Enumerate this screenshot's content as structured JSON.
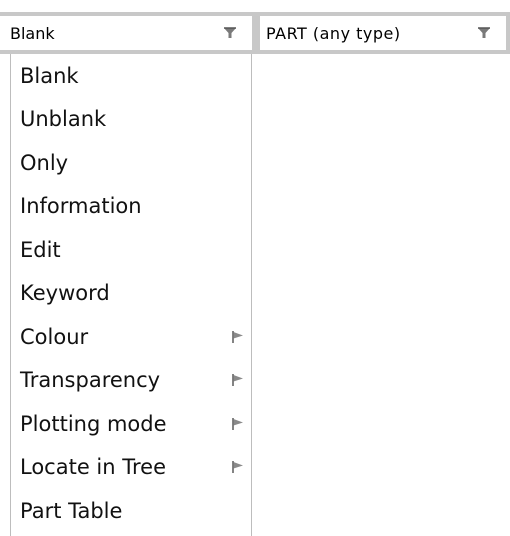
{
  "combo_left": {
    "value": "Blank",
    "arrow_icon": "filter-funnel-icon"
  },
  "combo_right": {
    "value": "PART  (any type)",
    "arrow_icon": "filter-funnel-icon"
  },
  "menu": {
    "items": [
      {
        "label": "Blank",
        "has_submenu": false
      },
      {
        "label": "Unblank",
        "has_submenu": false
      },
      {
        "label": "Only",
        "has_submenu": false
      },
      {
        "label": "Information",
        "has_submenu": false
      },
      {
        "label": "Edit",
        "has_submenu": false
      },
      {
        "label": "Keyword",
        "has_submenu": false
      },
      {
        "label": "Colour",
        "has_submenu": true
      },
      {
        "label": "Transparency",
        "has_submenu": true
      },
      {
        "label": "Plotting mode",
        "has_submenu": true
      },
      {
        "label": "Locate in Tree",
        "has_submenu": true
      },
      {
        "label": "Part Table",
        "has_submenu": false
      }
    ]
  },
  "colors": {
    "combo_border": "#c8c8c8",
    "menu_border": "#bdbdbd",
    "arrow": "#7a7a7a"
  }
}
